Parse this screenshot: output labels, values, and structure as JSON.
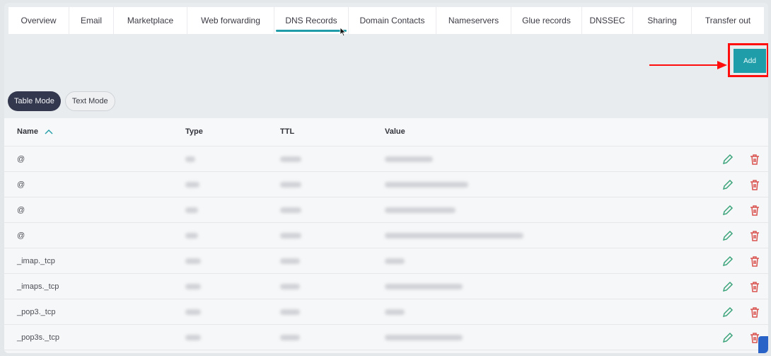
{
  "tabs": [
    {
      "label": "Overview",
      "active": false
    },
    {
      "label": "Email",
      "active": false
    },
    {
      "label": "Marketplace",
      "active": false
    },
    {
      "label": "Web forwarding",
      "active": false
    },
    {
      "label": "DNS Records",
      "active": true
    },
    {
      "label": "Domain Contacts",
      "active": false
    },
    {
      "label": "Nameservers",
      "active": false
    },
    {
      "label": "Glue records",
      "active": false
    },
    {
      "label": "DNSSEC",
      "active": false
    },
    {
      "label": "Sharing",
      "active": false
    },
    {
      "label": "Transfer out",
      "active": false
    }
  ],
  "toolbar": {
    "add_label": "Add"
  },
  "modes": {
    "table_label": "Table Mode",
    "text_label": "Text Mode",
    "active": "table"
  },
  "table": {
    "headers": {
      "name": "Name",
      "type": "Type",
      "ttl": "TTL",
      "value": "Value"
    },
    "sort_icon": "chevron-up-icon",
    "rows": [
      {
        "name": "@"
      },
      {
        "name": "@"
      },
      {
        "name": "@"
      },
      {
        "name": "@"
      },
      {
        "name": "_imap._tcp"
      },
      {
        "name": "_imaps._tcp"
      },
      {
        "name": "_pop3._tcp"
      },
      {
        "name": "_pop3s._tcp"
      }
    ]
  },
  "colors": {
    "accent": "#1f9da8",
    "highlight": "#ff0e0e",
    "delete": "#d9534f",
    "edit": "#3aa37a"
  }
}
